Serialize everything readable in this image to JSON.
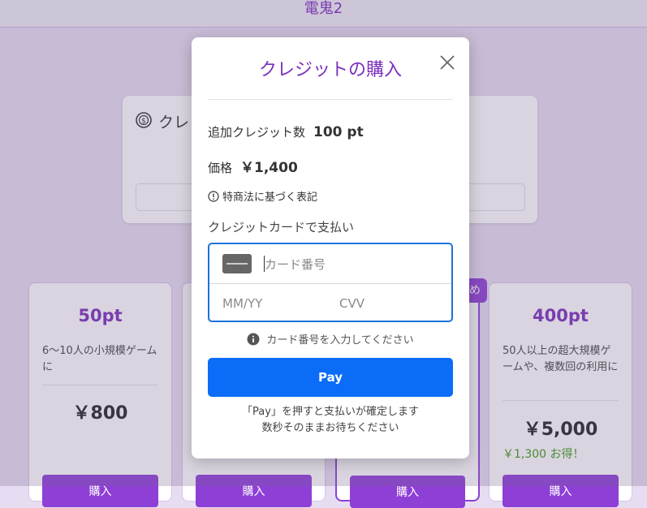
{
  "app": {
    "title": "電鬼2"
  },
  "balance_card": {
    "title": "クレ"
  },
  "plans": [
    {
      "name": "50pt",
      "desc": "6〜10人の小規模ゲームに",
      "price": "￥800",
      "saving": "",
      "buy": "購入"
    },
    {
      "name": "",
      "desc": "",
      "price": "",
      "saving": "",
      "buy": "購入"
    },
    {
      "name": "",
      "desc": "",
      "price": "",
      "saving": "",
      "buy": "購入"
    },
    {
      "name": "400pt",
      "desc": "50人以上の超大規模ゲームや、複数回の利用に",
      "price": "￥5,000",
      "saving": "￥1,300 お得！",
      "buy": "購入"
    }
  ],
  "recommend_badge": "め",
  "modal": {
    "title": "クレジットの購入",
    "credit_label": "追加クレジット数",
    "credit_value": "100 pt",
    "price_label": "価格",
    "price_value": "￥1,400",
    "law_link": "特商法に基づく表記",
    "pay_method_label": "クレジットカードで支払い",
    "card_number_placeholder": "カード番号",
    "expiry_placeholder": "MM/YY",
    "cvv_placeholder": "CVV",
    "hint": "カード番号を入力してください",
    "pay_button": "Pay",
    "note_line1": "「Pay」を押すと支払いが確定します",
    "note_line2": "数秒そのままお待ちください"
  },
  "colors": {
    "accent": "#7b2fbd",
    "pay_button": "#0a6cf7",
    "saving": "#3c9a17"
  }
}
